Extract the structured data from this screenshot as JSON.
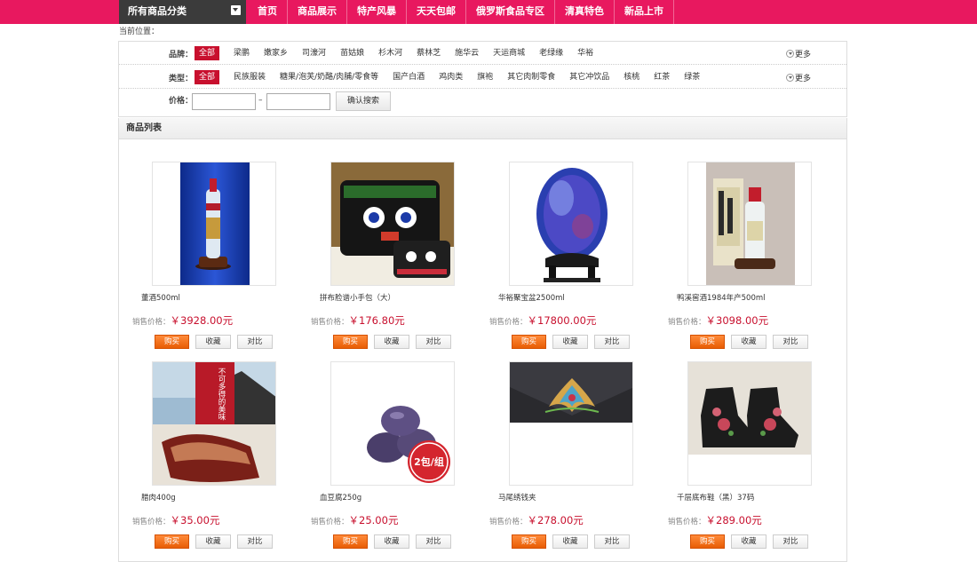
{
  "nav": {
    "category_label": "所有商品分类",
    "items": [
      "首页",
      "商品展示",
      "特产风暴",
      "天天包邮",
      "俄罗斯食品专区",
      "清真特色",
      "新品上市"
    ]
  },
  "breadcrumb": "当前位置：",
  "filters": {
    "brand_label": "品牌：",
    "brands": [
      "全部",
      "梁鹏",
      "嫩家乡",
      "司濠河",
      "苗姑娘",
      "杉木河",
      "蔡林芝",
      "施华云",
      "天运商城",
      "老绿缘",
      "华裕"
    ],
    "type_label": "类型：",
    "types": [
      "全部",
      "民族服装",
      "糖果/泡芙/奶酪/肉脯/零食等",
      "国产白酒",
      "鸡肉类",
      "旗袍",
      "其它肉制零食",
      "其它冲饮品",
      "核桃",
      "红茶",
      "绿茶"
    ],
    "more_label": "更多",
    "price_label": "价格：",
    "price_min": "",
    "price_max": "",
    "price_dash": "–",
    "search_button": "确认搜索"
  },
  "list_title": "商品列表",
  "price_prefix": "销售价格：",
  "buttons": {
    "buy": "购买",
    "favorite": "收藏",
    "compare": "对比"
  },
  "products": [
    {
      "name": "董酒500ml",
      "price": "￥3928.00元"
    },
    {
      "name": "拼布脸谱小手包（大）",
      "price": "￥176.80元"
    },
    {
      "name": "华裕聚宝盆2500ml",
      "price": "￥17800.00元"
    },
    {
      "name": "鸭溪窖酒1984年产500ml",
      "price": "￥3098.00元"
    },
    {
      "name": "腊肉400g",
      "price": "￥35.00元"
    },
    {
      "name": "血豆腐250g",
      "price": "￥25.00元"
    },
    {
      "name": "马尾绣钱夹",
      "price": "￥278.00元"
    },
    {
      "name": "千层底布鞋（黑）37码",
      "price": "￥289.00元"
    }
  ],
  "overlays": {
    "pork_banner": "不可多得的美味",
    "tofu_badge": "2包/组"
  },
  "colors": {
    "nav_bg": "#e8185f",
    "category_bg": "#3b3b3b",
    "accent_red": "#c8102e",
    "buy_orange": "#e85d04"
  }
}
